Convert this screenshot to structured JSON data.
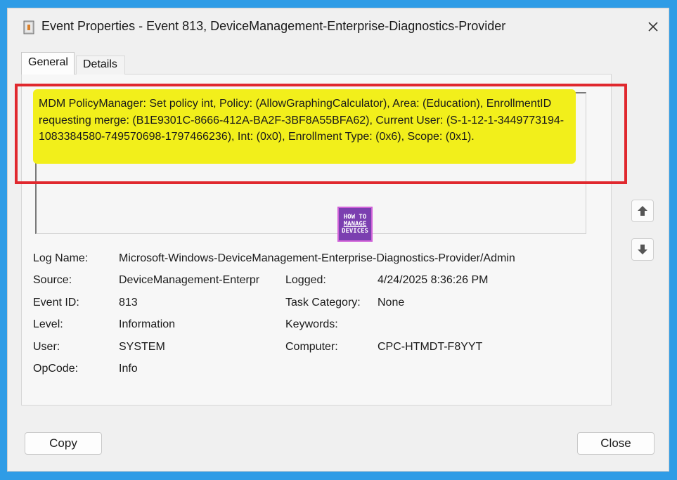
{
  "window": {
    "title": "Event Properties - Event 813, DeviceManagement-Enterprise-Diagnostics-Provider",
    "icon": "event-log-icon",
    "close_icon": "close-icon"
  },
  "tabs": [
    {
      "label": "General",
      "active": true
    },
    {
      "label": "Details",
      "active": false
    }
  ],
  "description": "MDM PolicyManager: Set policy int, Policy: (AllowGraphingCalculator), Area: (Education), EnrollmentID requesting merge: (B1E9301C-8666-412A-BA2F-3BF8A55BFA62), Current User: (S-1-12-1-3449773194-1083384580-749570698-1797466236), Int: (0x0), Enrollment Type: (0x6), Scope: (0x1).",
  "logo": {
    "line1": "HOW TO",
    "line2": "MANAGE",
    "line3": "DEVICES"
  },
  "fields": {
    "log_name": {
      "label": "Log Name:",
      "value": "Microsoft-Windows-DeviceManagement-Enterprise-Diagnostics-Provider/Admin"
    },
    "source": {
      "label": "Source:",
      "value": "DeviceManagement-Enterpr"
    },
    "logged": {
      "label": "Logged:",
      "value": "4/24/2025 8:36:26 PM"
    },
    "event_id": {
      "label": "Event ID:",
      "value": "813"
    },
    "task_category": {
      "label": "Task Category:",
      "value": "None"
    },
    "level": {
      "label": "Level:",
      "value": "Information"
    },
    "keywords": {
      "label": "Keywords:",
      "value": ""
    },
    "user": {
      "label": "User:",
      "value": "SYSTEM"
    },
    "computer": {
      "label": "Computer:",
      "value": "CPC-HTMDT-F8YYT"
    },
    "opcode": {
      "label": "OpCode:",
      "value": "Info"
    }
  },
  "buttons": {
    "copy": "Copy",
    "close": "Close"
  },
  "colors": {
    "highlight": "#f2ef1b",
    "annotation_border": "#e0282e",
    "frame": "#2f9ce6"
  }
}
